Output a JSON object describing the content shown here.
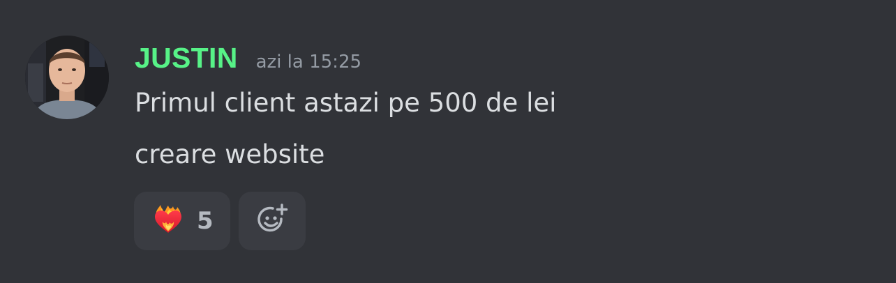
{
  "message": {
    "author": "JUSTIN",
    "author_color": "#57f287",
    "timestamp": "azi la 15:25",
    "lines": [
      "Primul client astazi pe 500 de lei",
      "creare website"
    ],
    "reactions": [
      {
        "emoji": "heart-on-fire-icon",
        "count": "5"
      }
    ],
    "add_reaction_icon": "add-reaction-smiley-icon"
  }
}
